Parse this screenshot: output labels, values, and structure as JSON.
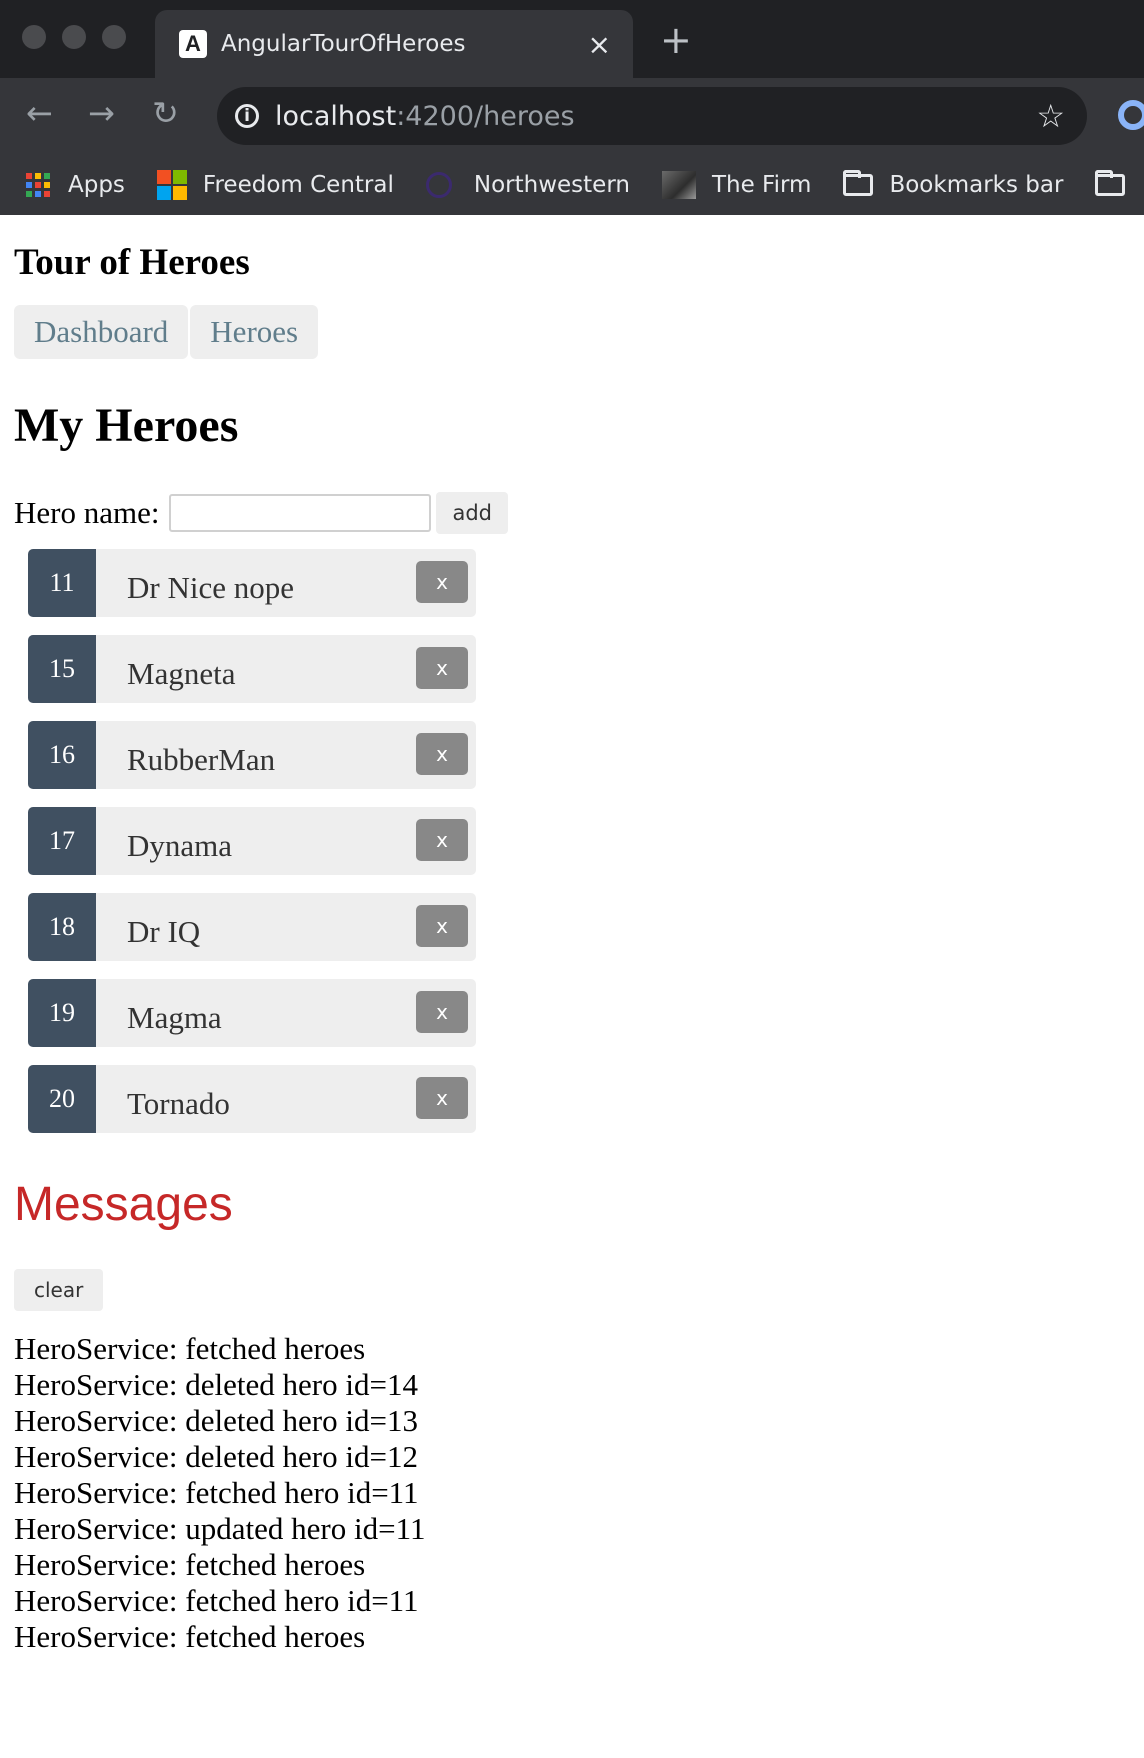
{
  "browser": {
    "tab": {
      "favicon": "A",
      "title": "AngularTourOfHeroes",
      "close": "×"
    },
    "new_tab": "+",
    "nav": {
      "back": "←",
      "forward": "→",
      "reload": "↻"
    },
    "address": {
      "host": "localhost",
      "path": ":4200/heroes"
    },
    "star": "☆",
    "bookmarks": [
      {
        "label": "Apps",
        "icon": "apps-grid-icon"
      },
      {
        "label": "Freedom Central",
        "icon": "windows-logo-icon"
      },
      {
        "label": "Northwestern",
        "icon": "ring-icon"
      },
      {
        "label": "The Firm",
        "icon": "photo-icon"
      },
      {
        "label": "Bookmarks bar",
        "icon": "folder-icon"
      }
    ]
  },
  "app": {
    "title": "Tour of Heroes",
    "nav": {
      "dashboard": "Dashboard",
      "heroes": "Heroes"
    }
  },
  "heroes_page": {
    "title": "My Heroes",
    "form": {
      "label": "Hero name:",
      "value": "",
      "add": "add"
    },
    "heroes": [
      {
        "id": "11",
        "name": "Dr Nice nope"
      },
      {
        "id": "15",
        "name": "Magneta"
      },
      {
        "id": "16",
        "name": "RubberMan"
      },
      {
        "id": "17",
        "name": "Dynama"
      },
      {
        "id": "18",
        "name": "Dr IQ"
      },
      {
        "id": "19",
        "name": "Magma"
      },
      {
        "id": "20",
        "name": "Tornado"
      }
    ],
    "delete_label": "x"
  },
  "messages": {
    "title": "Messages",
    "clear": "clear",
    "items": [
      "HeroService: fetched heroes",
      "HeroService: deleted hero id=14",
      "HeroService: deleted hero id=13",
      "HeroService: deleted hero id=12",
      "HeroService: fetched hero id=11",
      "HeroService: updated hero id=11",
      "HeroService: fetched heroes",
      "HeroService: fetched hero id=11",
      "HeroService: fetched heroes"
    ]
  },
  "colors": {
    "chrome_dark": "#202124",
    "chrome": "#35363a",
    "badge": "#405061",
    "messages_title": "#c62828",
    "nav_text": "#607d8b"
  }
}
